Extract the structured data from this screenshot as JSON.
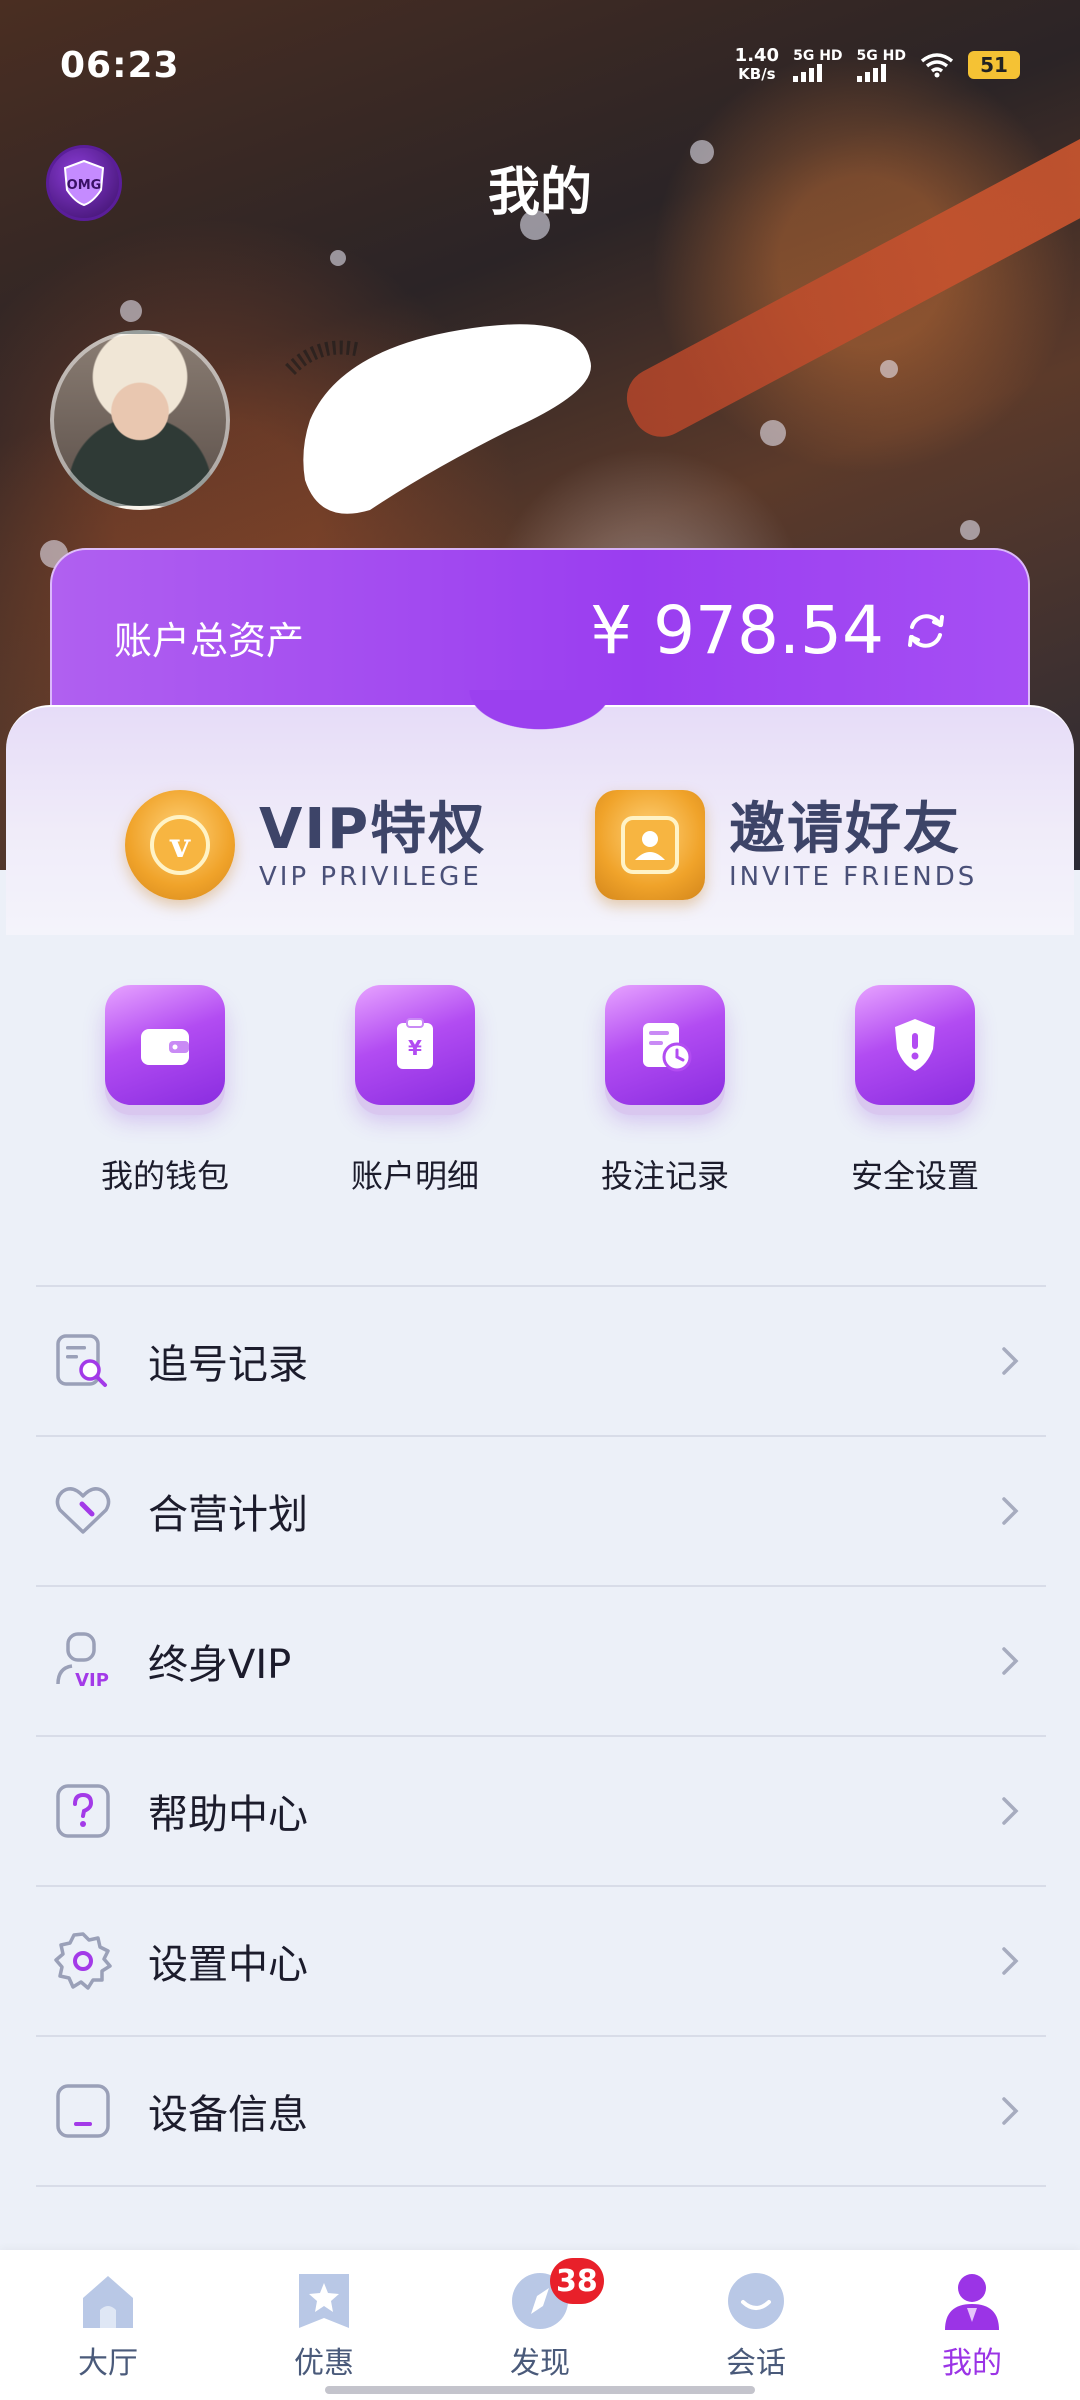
{
  "status_bar": {
    "time": "06:23",
    "net_speed_value": "1.40",
    "net_speed_unit": "KB/s",
    "sim1": "5G HD",
    "sim2": "5G HD",
    "battery": "51"
  },
  "header": {
    "title": "我的",
    "logo_text": "OMG"
  },
  "account": {
    "label": "账户总资产",
    "total": "¥ 978.54"
  },
  "features": [
    {
      "title": "VIP特权",
      "subtitle": "VIP PRIVILEGE",
      "icon": "vip-badge-icon"
    },
    {
      "title": "邀请好友",
      "subtitle": "INVITE FRIENDS",
      "icon": "invite-friends-icon"
    }
  ],
  "quick_actions": [
    {
      "label": "我的钱包",
      "icon": "wallet-icon"
    },
    {
      "label": "账户明细",
      "icon": "statement-icon"
    },
    {
      "label": "投注记录",
      "icon": "bet-record-icon"
    },
    {
      "label": "安全设置",
      "icon": "shield-icon"
    }
  ],
  "menu": [
    {
      "label": "追号记录",
      "icon": "search-record-icon"
    },
    {
      "label": "合营计划",
      "icon": "partnership-icon"
    },
    {
      "label": "终身VIP",
      "icon": "lifetime-vip-icon"
    },
    {
      "label": "帮助中心",
      "icon": "help-icon"
    },
    {
      "label": "设置中心",
      "icon": "settings-gear-icon"
    },
    {
      "label": "设备信息",
      "icon": "device-icon"
    }
  ],
  "bottom_nav": {
    "items": [
      {
        "label": "大厅",
        "icon": "home-icon"
      },
      {
        "label": "优惠",
        "icon": "star-badge-icon"
      },
      {
        "label": "发现",
        "icon": "compass-icon",
        "badge": "38"
      },
      {
        "label": "会话",
        "icon": "chat-face-icon"
      },
      {
        "label": "我的",
        "icon": "profile-icon"
      }
    ],
    "active_index": 4
  },
  "colors": {
    "accent": "#9b34e6",
    "card": "#9a3df0",
    "badge": "#e8202a",
    "gold": "#f0a32a"
  }
}
